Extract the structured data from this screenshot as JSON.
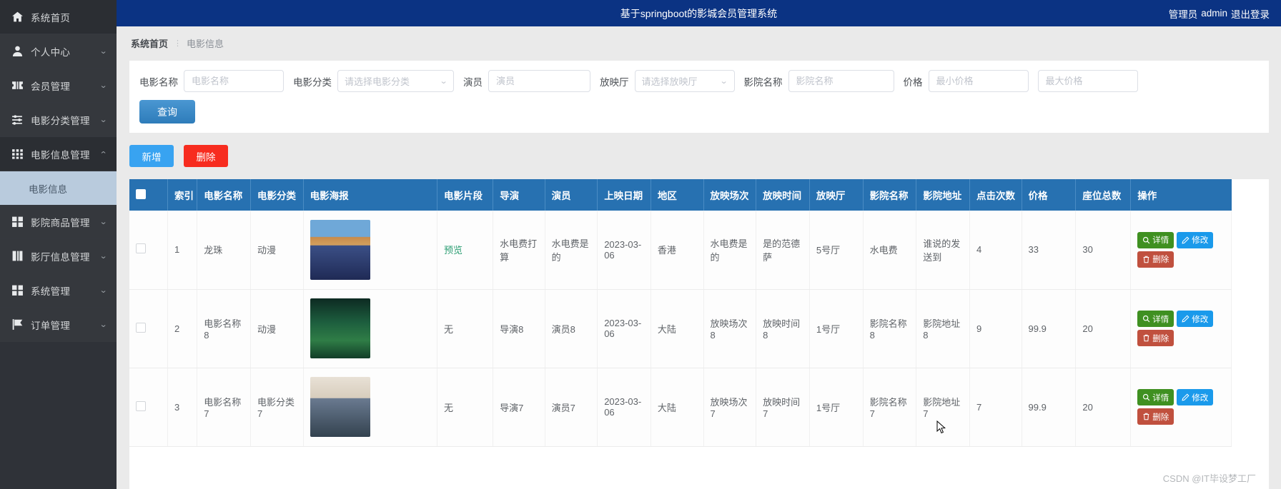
{
  "header": {
    "title": "基于springboot的影城会员管理系统",
    "role": "管理员",
    "username": "admin",
    "logout": "退出登录"
  },
  "sidebar": {
    "items": [
      {
        "label": "系统首页",
        "icon": "home-icon",
        "expandable": false
      },
      {
        "label": "个人中心",
        "icon": "user-icon",
        "expandable": true
      },
      {
        "label": "会员管理",
        "icon": "ticket-icon",
        "expandable": true
      },
      {
        "label": "电影分类管理",
        "icon": "sliders-icon",
        "expandable": true
      },
      {
        "label": "电影信息管理",
        "icon": "grid-icon",
        "expandable": true,
        "open": true
      },
      {
        "label": "影院商品管理",
        "icon": "squares-icon",
        "expandable": true
      },
      {
        "label": "影厅信息管理",
        "icon": "book-icon",
        "expandable": true
      },
      {
        "label": "系统管理",
        "icon": "squares-icon",
        "expandable": true
      },
      {
        "label": "订单管理",
        "icon": "flag-icon",
        "expandable": true
      }
    ],
    "submenu_label": "电影信息"
  },
  "breadcrumb": {
    "root": "系统首页",
    "separator": "⋮",
    "current": "电影信息"
  },
  "search": {
    "fields": [
      {
        "label": "电影名称",
        "placeholder": "电影名称",
        "value": "",
        "type": "text"
      },
      {
        "label": "电影分类",
        "placeholder": "请选择电影分类",
        "value": "",
        "type": "select"
      },
      {
        "label": "演员",
        "placeholder": "演员",
        "value": "",
        "type": "text"
      },
      {
        "label": "放映厅",
        "placeholder": "请选择放映厅",
        "value": "",
        "type": "select"
      },
      {
        "label": "影院名称",
        "placeholder": "影院名称",
        "value": "",
        "type": "text"
      },
      {
        "label": "价格",
        "placeholder": "最小价格",
        "value": "",
        "type": "text"
      },
      {
        "label": "",
        "placeholder": "最大价格",
        "value": "",
        "type": "text"
      }
    ],
    "query_button": "查询"
  },
  "toolbar": {
    "add_label": "新增",
    "delete_label": "删除"
  },
  "table": {
    "columns": [
      "",
      "索引",
      "电影名称",
      "电影分类",
      "电影海报",
      "电影片段",
      "导演",
      "演员",
      "上映日期",
      "地区",
      "放映场次",
      "放映时间",
      "放映厅",
      "影院名称",
      "影院地址",
      "点击次数",
      "价格",
      "座位总数",
      "操作"
    ],
    "preview_label": "预览",
    "row_actions": {
      "detail": "详情",
      "edit": "修改",
      "delete": "删除"
    },
    "rows": [
      {
        "index": "1",
        "name": "龙珠",
        "category": "动漫",
        "poster_alt": "龙珠海报",
        "clip": "预览",
        "director": "水电费打算",
        "actor": "水电费是的",
        "release_date": "2023-03-06",
        "region": "香港",
        "session": "水电费是的",
        "show_time": "是的范德萨",
        "hall": "5号厅",
        "cinema_name": "水电费",
        "cinema_addr": "谁说的发送到",
        "clicks": "4",
        "price": "33",
        "seats": "30"
      },
      {
        "index": "2",
        "name": "电影名称8",
        "category": "动漫",
        "poster_alt": "电影名称8海报",
        "clip": "无",
        "director": "导演8",
        "actor": "演员8",
        "release_date": "2023-03-06",
        "region": "大陆",
        "session": "放映场次8",
        "show_time": "放映时间8",
        "hall": "1号厅",
        "cinema_name": "影院名称8",
        "cinema_addr": "影院地址8",
        "clicks": "9",
        "price": "99.9",
        "seats": "20"
      },
      {
        "index": "3",
        "name": "电影名称7",
        "category": "电影分类7",
        "poster_alt": "电影名称7海报",
        "clip": "无",
        "director": "导演7",
        "actor": "演员7",
        "release_date": "2023-03-06",
        "region": "大陆",
        "session": "放映场次7",
        "show_time": "放映时间7",
        "hall": "1号厅",
        "cinema_name": "影院名称7",
        "cinema_addr": "影院地址7",
        "clicks": "7",
        "price": "99.9",
        "seats": "20"
      }
    ]
  },
  "watermark": "CSDN @IT毕设梦工厂",
  "colors": {
    "topbar": "#0b3383",
    "sidebar": "#2f3238",
    "table_header": "#2771b1",
    "add": "#38a3f1",
    "delete": "#f72c1f",
    "detail": "#3f9021",
    "edit": "#1a9aeb",
    "row_delete": "#c0503e"
  }
}
